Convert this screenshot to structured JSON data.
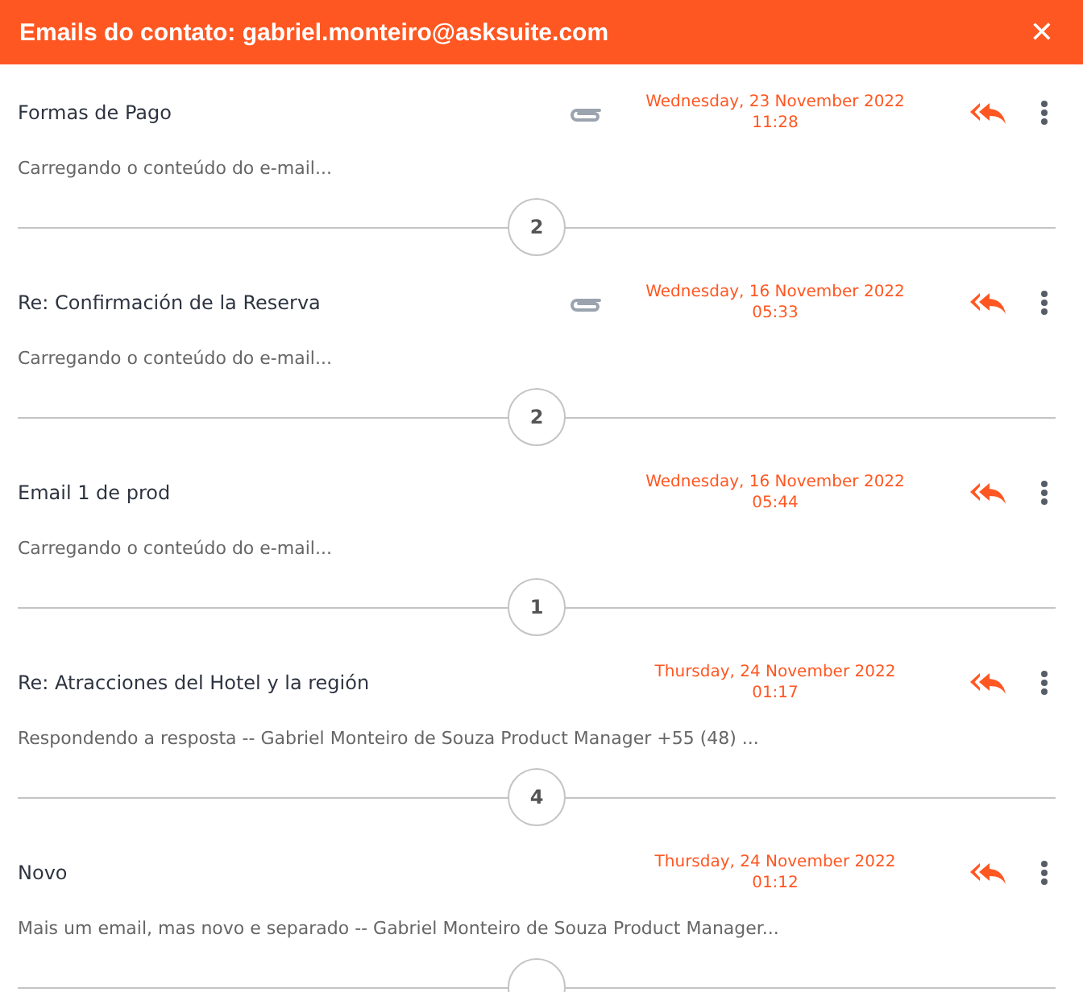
{
  "header": {
    "title": "Emails do contato: gabriel.monteiro@asksuite.com",
    "close": "✕"
  },
  "emails": [
    {
      "subject": "Formas de Pago",
      "attachment": true,
      "date": "Wednesday, 23 November 2022",
      "time": "11:28",
      "preview": "Carregando o conteúdo do e-mail...",
      "count": "2"
    },
    {
      "subject": "Re: Confirmación de la Reserva",
      "attachment": true,
      "date": "Wednesday, 16 November 2022",
      "time": "05:33",
      "preview": "Carregando o conteúdo do e-mail...",
      "count": "2"
    },
    {
      "subject": "Email 1 de prod",
      "attachment": false,
      "date": "Wednesday, 16 November 2022",
      "time": "05:44",
      "preview": "Carregando o conteúdo do e-mail...",
      "count": "1"
    },
    {
      "subject": "Re: Atracciones del Hotel y la región",
      "attachment": false,
      "date": "Thursday, 24 November 2022",
      "time": "01:17",
      "preview": "Respondendo a resposta -- Gabriel Monteiro de Souza Product Manager +55 (48) ...",
      "count": "4"
    },
    {
      "subject": "Novo",
      "attachment": false,
      "date": "Thursday, 24 November 2022",
      "time": "01:12",
      "preview": "Mais um email, mas novo e separado -- Gabriel Monteiro de Souza Product Manager..."
    }
  ]
}
